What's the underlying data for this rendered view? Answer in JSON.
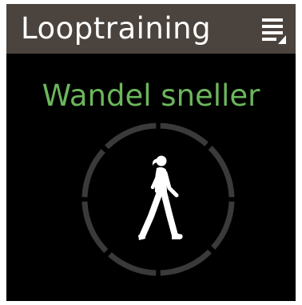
{
  "header": {
    "title": "Looptraining",
    "menu_icon": "menu-icon"
  },
  "main": {
    "instruction": "Wandel sneller",
    "figure_icon": "walking-person-icon"
  },
  "colors": {
    "header_bg": "#4b433d",
    "screen_bg": "#000000",
    "instruction_text": "#6cb65c",
    "dial_ring": "#3a3a3a"
  }
}
